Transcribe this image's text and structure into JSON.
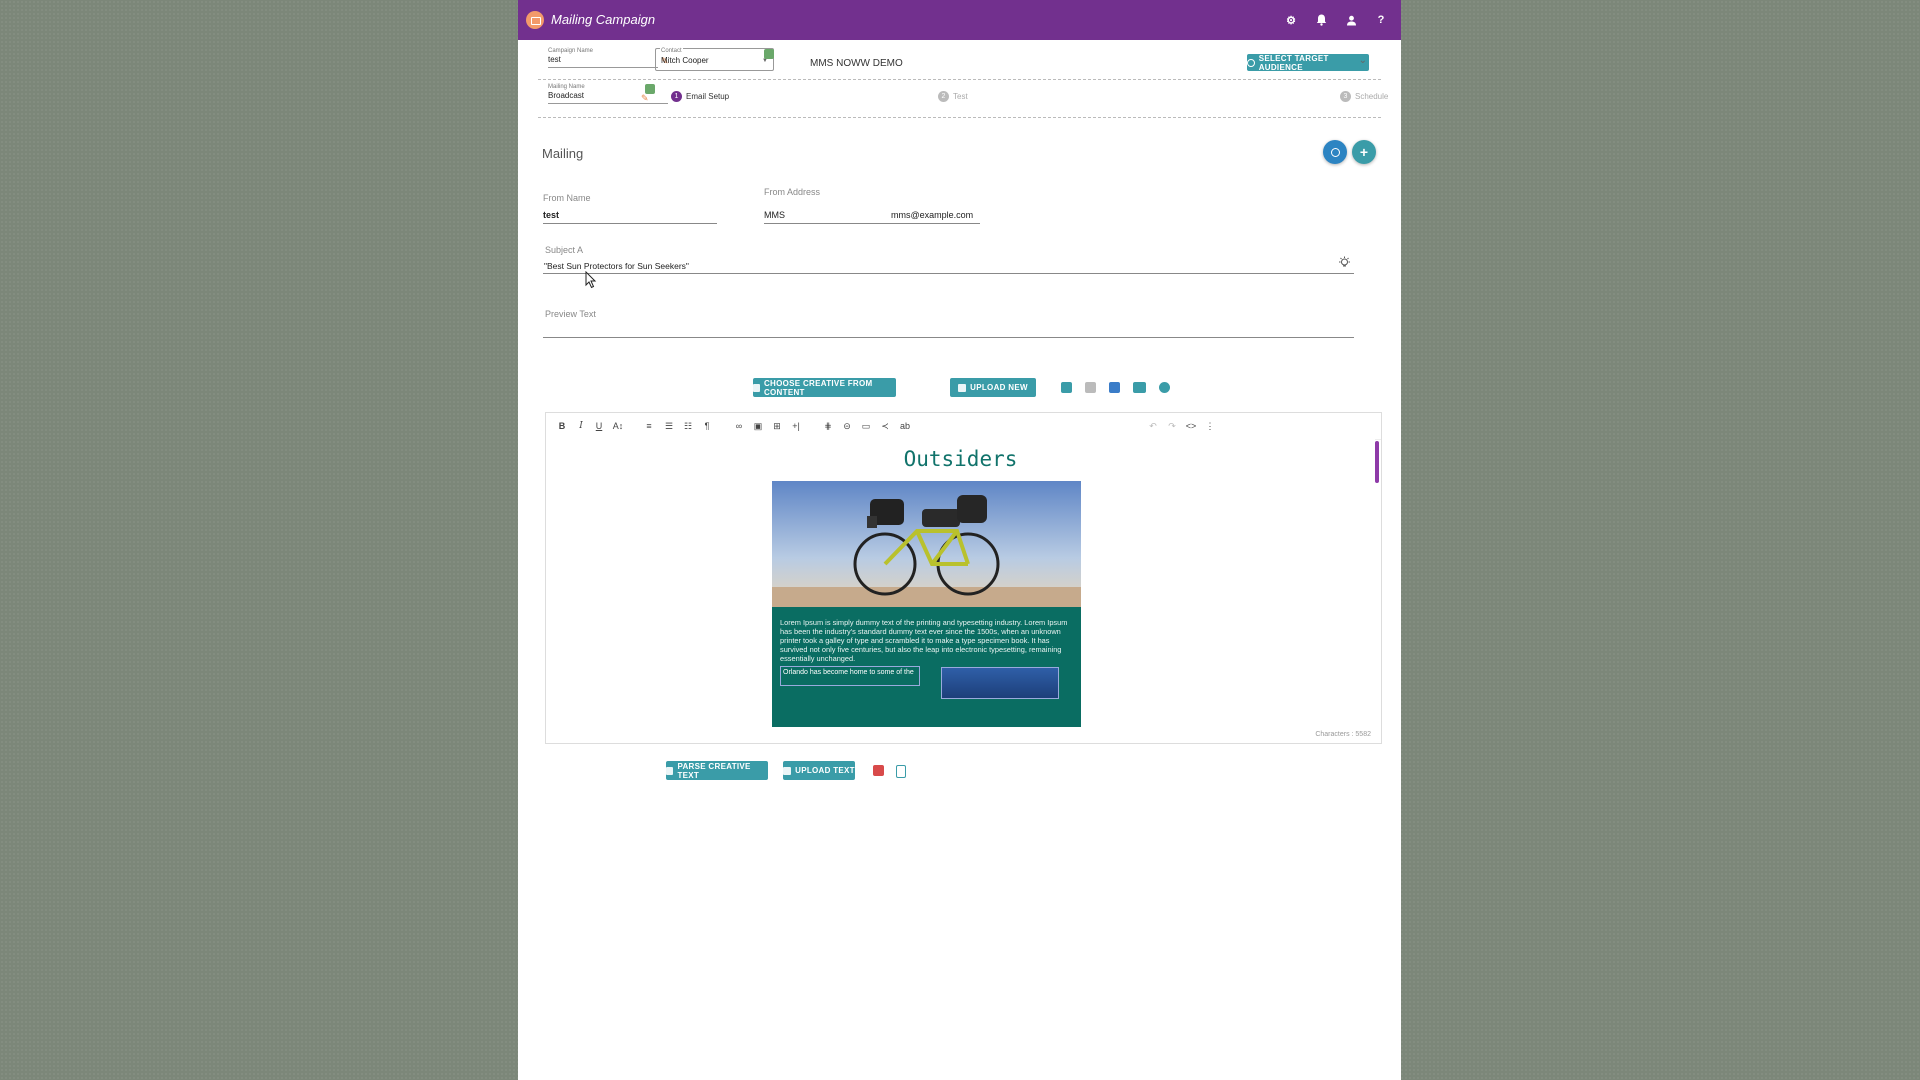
{
  "app": {
    "title": "Mailing Campaign"
  },
  "topbar_icons": [
    "gear-icon",
    "bell-icon",
    "user-icon",
    "help-icon"
  ],
  "campaign": {
    "campaign_name_label": "Campaign Name",
    "campaign_name_value": "test",
    "contact_label": "Contact",
    "contact_value": "Mitch Cooper",
    "account_name": "MMS NOWW DEMO",
    "select_audience_label": "SELECT TARGET AUDIENCE",
    "mailing_name_label": "Mailing Name",
    "mailing_name_value": "Broadcast"
  },
  "steps": [
    {
      "num": "1",
      "label": "Email Setup"
    },
    {
      "num": "2",
      "label": "Test"
    },
    {
      "num": "3",
      "label": "Schedule"
    }
  ],
  "mailing": {
    "title": "Mailing",
    "from_name_label": "From Name",
    "from_name_value": "test",
    "from_address_label": "From Address",
    "from_address_prefix": "MMS",
    "from_address_email": "mms@example.com",
    "subject_label": "Subject A",
    "subject_value": "\"Best Sun Protectors for Sun Seekers\"",
    "preview_text_label": "Preview Text",
    "preview_text_value": ""
  },
  "actions": {
    "choose_creative": "CHOOSE CREATIVE FROM CONTENT",
    "upload_new": "UPLOAD NEW",
    "parse_creative_text": "PARSE CREATIVE TEXT",
    "upload_text": "UPLOAD TEXT"
  },
  "editor": {
    "email_title": "Outsiders",
    "lorem": "Lorem Ipsum is simply dummy text of the printing and typesetting industry. Lorem Ipsum has been the industry's standard dummy text ever since the 1500s, when an unknown printer took a galley of type and scrambled it to make a type specimen book. It has survived not only five centuries, but also the leap into electronic typesetting, remaining essentially unchanged.",
    "orlando_text": "Orlando has become home to some of the",
    "characters_label": "Characters : 5582"
  },
  "colors": {
    "topbar": "#72308e",
    "accent": "#3a9ca8",
    "email_teal": "#0a6d62",
    "email_title": "#11736b"
  }
}
